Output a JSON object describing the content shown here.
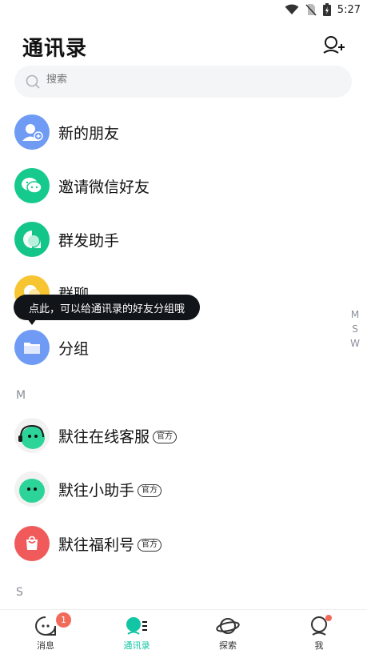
{
  "status_bar": {
    "time": "5:27"
  },
  "header": {
    "title": "通讯录"
  },
  "search": {
    "placeholder": "搜索"
  },
  "menu_items": [
    {
      "label": "新的朋友",
      "icon": "new-friend-icon",
      "color": "#6f9bf5"
    },
    {
      "label": "邀请微信好友",
      "icon": "wechat-icon",
      "color": "#16c98d"
    },
    {
      "label": "群发助手",
      "icon": "broadcast-icon",
      "color": "#14c58a"
    },
    {
      "label": "群聊",
      "icon": "group-chat-icon",
      "color": "#f7c531"
    },
    {
      "label": "分组",
      "icon": "folder-icon",
      "color": "#6f9bf5"
    }
  ],
  "tooltip": {
    "text": "点此，可以给通讯录的好友分组哦"
  },
  "index_letters": [
    "M",
    "S",
    "W"
  ],
  "sections": [
    {
      "letter": "M",
      "contacts": [
        {
          "name": "默往在线客服",
          "badge": "官方",
          "avatar": "service-avatar-icon"
        },
        {
          "name": "默往小助手",
          "badge": "官方",
          "avatar": "assistant-avatar-icon"
        },
        {
          "name": "默往福利号",
          "badge": "官方",
          "avatar": "gift-bag-avatar-icon"
        }
      ]
    },
    {
      "letter": "S",
      "contacts": []
    }
  ],
  "tabs": [
    {
      "label": "消息",
      "icon": "message-icon",
      "badge": "1"
    },
    {
      "label": "通讯录",
      "icon": "contacts-icon",
      "active": true
    },
    {
      "label": "探索",
      "icon": "planet-icon"
    },
    {
      "label": "我",
      "icon": "profile-icon"
    }
  ],
  "colors": {
    "accent": "#11c5a5",
    "badge": "#f26a5a",
    "tooltip_bg": "#111418"
  }
}
